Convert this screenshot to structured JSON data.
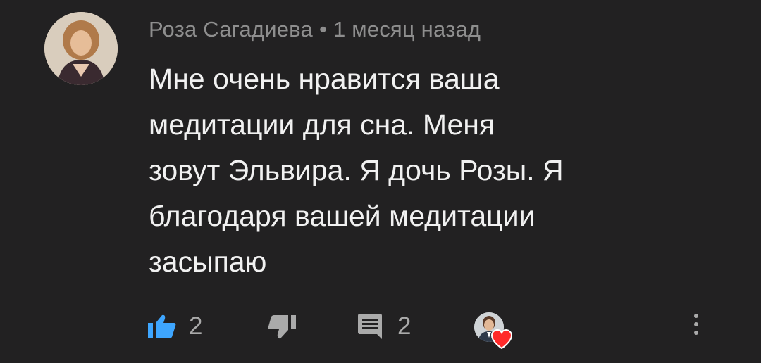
{
  "comment": {
    "author": "Роза Сагадиева",
    "separator": "•",
    "time": "1 месяц назад",
    "lines": [
      "Мне очень нравится ваша",
      "медитации для сна. Меня",
      "зовут Эльвира. Я дочь Розы. Я",
      "благодаря вашей медитации",
      "засыпаю"
    ]
  },
  "actions": {
    "like_count": "2",
    "reply_count": "2"
  },
  "colors": {
    "background": "#222122",
    "text": "#f1f1f1",
    "muted": "#8e8e8e",
    "like_active": "#3ea6ff",
    "heart": "#ff2a2a"
  },
  "icons": {
    "like": "thumbs-up-icon",
    "dislike": "thumbs-down-icon",
    "reply": "comment-icon",
    "hearted": "creator-heart-icon",
    "more": "more-vertical-icon"
  }
}
